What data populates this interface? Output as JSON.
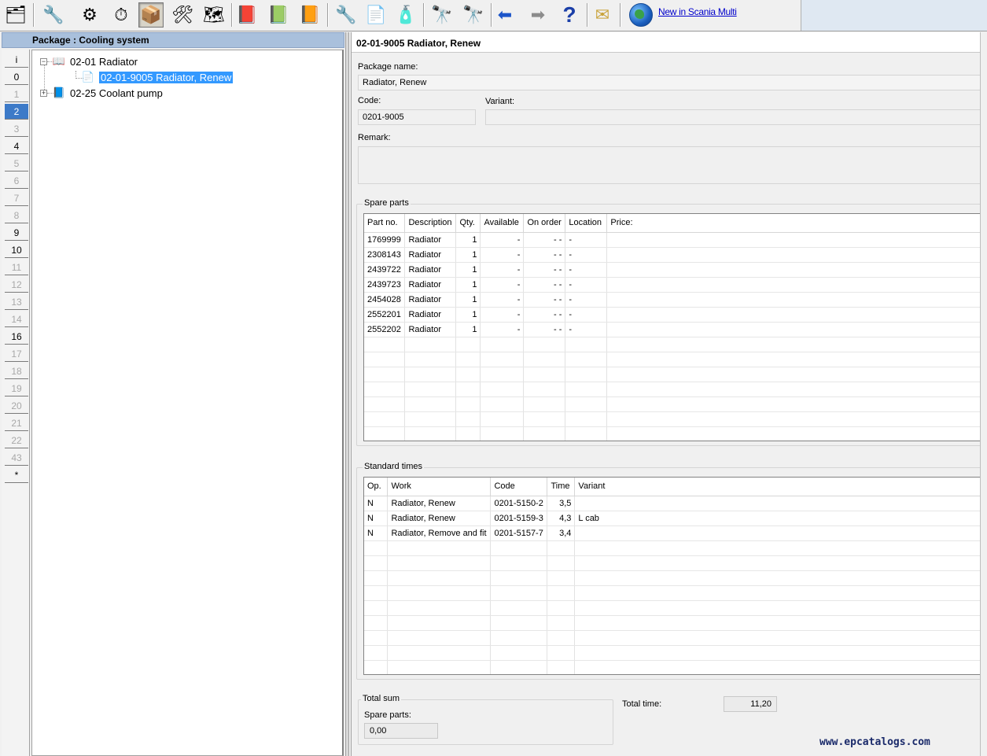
{
  "toolbar": {
    "buttons": [
      {
        "name": "structure",
        "icon": "structure-tree-icon",
        "glyph": "🗂"
      },
      {
        "name": "info",
        "icon": "info-tools-icon",
        "glyph": "🔧"
      },
      {
        "name": "engine-parts",
        "icon": "engine-gear-icon",
        "glyph": "⚙"
      },
      {
        "name": "stopwatch",
        "icon": "stopwatch-icon",
        "glyph": "⏱"
      },
      {
        "name": "package",
        "icon": "package-box-icon",
        "glyph": "📦"
      },
      {
        "name": "work-procedure",
        "icon": "work-procedure-icon",
        "glyph": "🛠"
      },
      {
        "name": "diagram",
        "icon": "diagram-icon",
        "glyph": "🗺"
      },
      {
        "name": "book",
        "icon": "book-icon",
        "glyph": "📕"
      },
      {
        "name": "book-approved",
        "icon": "book-check-icon",
        "glyph": "📗"
      },
      {
        "name": "book-edit",
        "icon": "book-pen-icon",
        "glyph": "📙"
      },
      {
        "name": "wrench",
        "icon": "wrench-icon",
        "glyph": "🔧"
      },
      {
        "name": "technical-info",
        "icon": "ti-document-icon",
        "glyph": "📄"
      },
      {
        "name": "spray",
        "icon": "spray-bottle-icon",
        "glyph": "🧴"
      },
      {
        "name": "search",
        "icon": "binoculars-icon",
        "glyph": "🔭"
      },
      {
        "name": "search-plus",
        "icon": "binoculars-plus-icon",
        "glyph": "🔭"
      },
      {
        "name": "back",
        "icon": "back-arrow-icon",
        "glyph": "⬅"
      },
      {
        "name": "forward",
        "icon": "forward-arrow-icon",
        "glyph": "➡"
      },
      {
        "name": "help",
        "icon": "help-icon",
        "glyph": "?"
      },
      {
        "name": "mail",
        "icon": "mail-icon",
        "glyph": "✉"
      }
    ],
    "link_label": "New in Scania Multi"
  },
  "left": {
    "header": "Package : Cooling system",
    "tabs": [
      {
        "label": "i",
        "state": "normal"
      },
      {
        "label": "0",
        "state": "normal"
      },
      {
        "label": "1",
        "state": "disabled"
      },
      {
        "label": "2",
        "state": "selected"
      },
      {
        "label": "3",
        "state": "disabled"
      },
      {
        "label": "4",
        "state": "normal"
      },
      {
        "label": "5",
        "state": "disabled"
      },
      {
        "label": "6",
        "state": "disabled"
      },
      {
        "label": "7",
        "state": "disabled"
      },
      {
        "label": "8",
        "state": "disabled"
      },
      {
        "label": "9",
        "state": "normal"
      },
      {
        "label": "10",
        "state": "normal"
      },
      {
        "label": "11",
        "state": "disabled"
      },
      {
        "label": "12",
        "state": "disabled"
      },
      {
        "label": "13",
        "state": "disabled"
      },
      {
        "label": "14",
        "state": "disabled"
      },
      {
        "label": "16",
        "state": "normal"
      },
      {
        "label": "17",
        "state": "disabled"
      },
      {
        "label": "18",
        "state": "disabled"
      },
      {
        "label": "19",
        "state": "disabled"
      },
      {
        "label": "20",
        "state": "disabled"
      },
      {
        "label": "21",
        "state": "disabled"
      },
      {
        "label": "22",
        "state": "disabled"
      },
      {
        "label": "43",
        "state": "disabled"
      },
      {
        "label": "*",
        "state": "normal"
      }
    ],
    "tree": {
      "radiator": "02-01 Radiator",
      "radiator_renew": "02-01-9005 Radiator, Renew",
      "coolant_pump": "02-25 Coolant pump"
    }
  },
  "right": {
    "title": "02-01-9005 Radiator, Renew",
    "package_name_label": "Package name:",
    "package_name": "Radiator, Renew",
    "code_label": "Code:",
    "code": "0201-9005",
    "variant_label": "Variant:",
    "variant": "",
    "remark_label": "Remark:",
    "remark": "",
    "spare_parts": {
      "title": "Spare parts",
      "columns": [
        "Part no.",
        "Description",
        "Qty.",
        "Available",
        "On order",
        "Location",
        "Price:"
      ],
      "rows": [
        [
          "1769999",
          "Radiator",
          "1",
          "-",
          "- -",
          "-",
          ""
        ],
        [
          "2308143",
          "Radiator",
          "1",
          "-",
          "- -",
          "-",
          ""
        ],
        [
          "2439722",
          "Radiator",
          "1",
          "-",
          "- -",
          "-",
          ""
        ],
        [
          "2439723",
          "Radiator",
          "1",
          "-",
          "- -",
          "-",
          ""
        ],
        [
          "2454028",
          "Radiator",
          "1",
          "-",
          "- -",
          "-",
          ""
        ],
        [
          "2552201",
          "Radiator",
          "1",
          "-",
          "- -",
          "-",
          ""
        ],
        [
          "2552202",
          "Radiator",
          "1",
          "-",
          "- -",
          "-",
          ""
        ]
      ]
    },
    "standard_times": {
      "title": "Standard times",
      "columns": [
        "Op.",
        "Work",
        "Code",
        "Time",
        "Variant"
      ],
      "rows": [
        [
          "N",
          "Radiator, Renew",
          "0201-5150-2",
          "3,5",
          ""
        ],
        [
          "N",
          "Radiator, Renew",
          "0201-5159-3",
          "4,3",
          "L cab"
        ],
        [
          "N",
          "Radiator, Remove and fit",
          "0201-5157-7",
          "3,4",
          ""
        ]
      ]
    },
    "totals": {
      "title": "Total sum",
      "spare_parts_label": "Spare parts:",
      "spare_parts_value": "0,00",
      "total_time_label": "Total time:",
      "total_time_value": "11,20"
    }
  },
  "watermark": "www.epcatalogs.com"
}
